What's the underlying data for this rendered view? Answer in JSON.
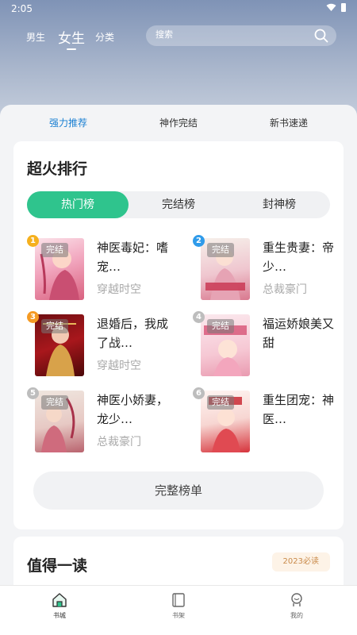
{
  "status": {
    "time": "2:05"
  },
  "top_nav": {
    "tabs": [
      "男生",
      "女生",
      "分类"
    ],
    "active": "女生",
    "search_placeholder": "搜索"
  },
  "sub_tabs": [
    "强力推荐",
    "神作完结",
    "新书速递"
  ],
  "ranking": {
    "title": "超火排行",
    "segments": [
      "热门榜",
      "完结榜",
      "封神榜"
    ],
    "active_segment": "热门榜",
    "status_tag": "完结",
    "books": [
      {
        "rank": "1",
        "title": "神医毒妃：嗜宠…",
        "category": "穿越时空"
      },
      {
        "rank": "2",
        "title": "重生贵妻：帝少…",
        "category": "总裁豪门"
      },
      {
        "rank": "3",
        "title": "退婚后，我成了战…",
        "category": "穿越时空"
      },
      {
        "rank": "4",
        "title": "福运娇娘美又甜",
        "category": ""
      },
      {
        "rank": "5",
        "title": "神医小娇妻，龙少…",
        "category": "总裁豪门"
      },
      {
        "rank": "6",
        "title": "重生团宠：神医…",
        "category": ""
      }
    ],
    "full_list_label": "完整榜单"
  },
  "worth_reading": {
    "title": "值得一读",
    "badge": "2023必读"
  },
  "bottom_nav": [
    {
      "label": "书城",
      "icon": "bookstore-icon"
    },
    {
      "label": "书架",
      "icon": "bookshelf-icon"
    },
    {
      "label": "我的",
      "icon": "profile-icon"
    }
  ],
  "colors": {
    "accent_green": "#2fc48d",
    "accent_blue": "#1a7fd2",
    "rank_badges": [
      "#f5b01e",
      "#2f9bea",
      "#f59a23",
      "#bdbdbd",
      "#bdbdbd",
      "#bdbdbd"
    ]
  }
}
